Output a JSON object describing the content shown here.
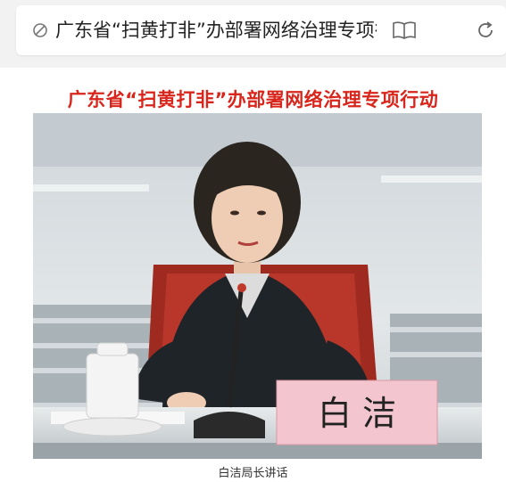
{
  "address_bar": {
    "url_text": "广东省“扫黄打非”办部署网络治理专项行动",
    "leading_icon": "slash-circle-icon",
    "reader_icon": "book-icon",
    "reload_icon": "reload-icon"
  },
  "article": {
    "headline": "广东省“扫黄打非”办部署网络治理专项行动",
    "headline_color": "#d9261c",
    "photo": {
      "nameplate_text": "白 洁"
    },
    "caption": "白洁局长讲话"
  }
}
